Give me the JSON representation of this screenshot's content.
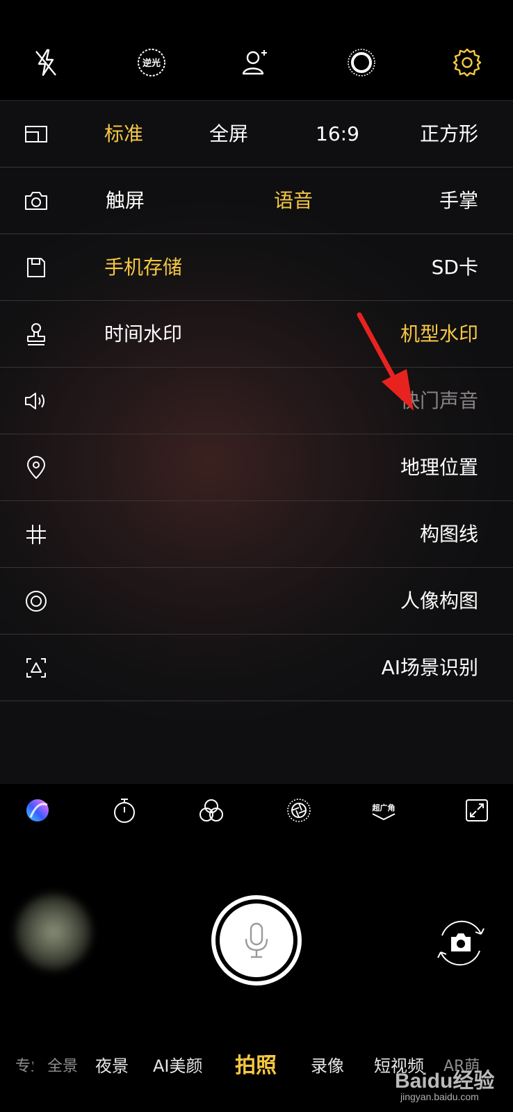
{
  "top_bar": {
    "icons": [
      "flash-off-icon",
      "backlight-icon",
      "portrait-plus-icon",
      "live-photo-icon",
      "gear-icon"
    ],
    "backlight_label": "逆光",
    "accent_color": "#f7c843"
  },
  "settings": {
    "rows": [
      {
        "icon": "aspect-ratio-icon",
        "options": [
          "标准",
          "全屏",
          "16:9",
          "正方形"
        ],
        "selected": "标准"
      },
      {
        "icon": "camera-icon",
        "options": [
          "触屏",
          "语音",
          "手掌"
        ],
        "selected": "语音"
      },
      {
        "icon": "storage-icon",
        "options": [
          "手机存储",
          "SD卡"
        ],
        "selected": "手机存储"
      },
      {
        "icon": "stamp-icon",
        "options": [
          "时间水印",
          "机型水印"
        ],
        "selected": "机型水印"
      },
      {
        "icon": "speaker-icon",
        "label": "快门声音",
        "enabled": false
      },
      {
        "icon": "location-pin-icon",
        "label": "地理位置"
      },
      {
        "icon": "grid-icon",
        "label": "构图线"
      },
      {
        "icon": "target-icon",
        "label": "人像构图"
      },
      {
        "icon": "ai-scene-icon",
        "label": "AI场景识别"
      }
    ]
  },
  "tool_bar": {
    "icons": [
      "color-ball-icon",
      "timer-icon",
      "filter-icon",
      "aperture-icon",
      "ultra-wide-icon",
      "expand-icon"
    ],
    "ultra_wide_label": "超广角"
  },
  "capture": {
    "shutter_icon": "microphone-icon",
    "flip_icon": "switch-camera-icon"
  },
  "modes": {
    "items": [
      "专业",
      "全景",
      "夜景",
      "AI美颜",
      "拍照",
      "录像",
      "短视频",
      "AR萌拍"
    ],
    "selected": "拍照"
  },
  "watermark": {
    "brand": "Baidu经验",
    "url": "jingyan.baidu.com"
  }
}
